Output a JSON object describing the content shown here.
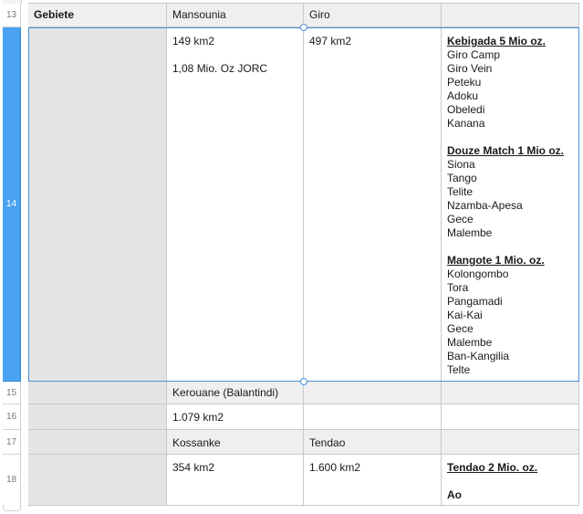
{
  "rows": {
    "r13": {
      "num": "13",
      "c1": "Gebiete",
      "c2": "Mansounia",
      "c3": "Giro",
      "c4": ""
    },
    "r14": {
      "num": "14",
      "c2_line1": "149 km2",
      "c2_line2": "1,08 Mio. Oz JORC",
      "c3_line1": "497 km2",
      "group1": {
        "title": "Kebigada  5 Mio oz.",
        "items": [
          "Giro Camp",
          "Giro Vein",
          "Peteku",
          "Adoku",
          "Obeledi",
          "Kanana"
        ]
      },
      "group2": {
        "title": "Douze Match 1 Mio oz.",
        "items": [
          "Siona",
          "Tango",
          "Telite",
          "Nzamba-Apesa",
          "Gece",
          "Malembe"
        ]
      },
      "group3": {
        "title": "Mangote 1 Mio. oz.",
        "items": [
          "Kolongombo",
          "Tora",
          "Pangamadi",
          "Kai-Kai",
          "Gece",
          "Malembe",
          "Ban-Kangilia",
          "Telte"
        ]
      }
    },
    "r15": {
      "num": "15",
      "c2": "Kerouane (Balantindi)"
    },
    "r16": {
      "num": "16",
      "c2": "1.079 km2"
    },
    "r17": {
      "num": "17",
      "c2": "Kossanke",
      "c3": "Tendao"
    },
    "r18": {
      "num": "18",
      "c2": "354 km2",
      "c3": "1.600 km2",
      "c4_title": "Tendao  2 Mio. oz.",
      "c4_line2": "Ao"
    }
  },
  "selection": {
    "row": "14",
    "accent": "#4aa3f0"
  }
}
